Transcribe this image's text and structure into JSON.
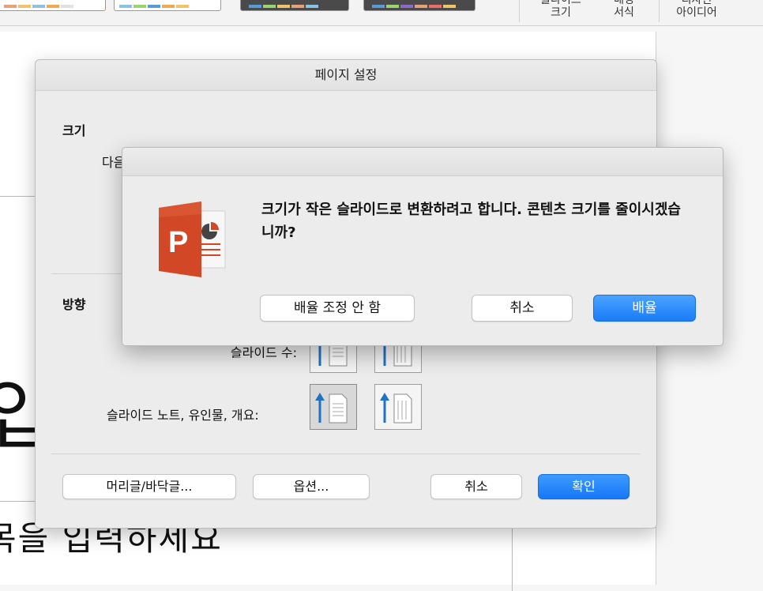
{
  "ribbon": {
    "slide_size_label_line1": "슬라이드",
    "slide_size_label_line2": "크기",
    "bg_format_label_line1": "배경",
    "bg_format_label_line2": "서식",
    "design_ideas_label_line1": "디자인",
    "design_ideas_label_line2": "아이디어"
  },
  "background": {
    "big_text": "입",
    "sub_text": "목을 입력하세요"
  },
  "page_setup": {
    "title": "페이지 설정",
    "size_heading": "크기",
    "size_partial_text": "다음",
    "orientation_heading": "방향",
    "slides_label": "슬라이드 수:",
    "notes_label": "슬라이드 노트, 유인물, 개요:",
    "header_footer_button": "머리글/바닥글...",
    "options_button": "옵션...",
    "cancel_button": "취소",
    "ok_button": "확인"
  },
  "alert": {
    "message": "크기가 작은 슬라이드로 변환하려고 합니다. 콘텐츠 크기를 줄이시겠습니까?",
    "dont_scale_button": "배율 조정 안 함",
    "cancel_button": "취소",
    "scale_button": "배율",
    "icon": "powerpoint-app-icon"
  },
  "colors": {
    "accent_blue": "#1a7cf7",
    "powerpoint_orange": "#d24726"
  }
}
